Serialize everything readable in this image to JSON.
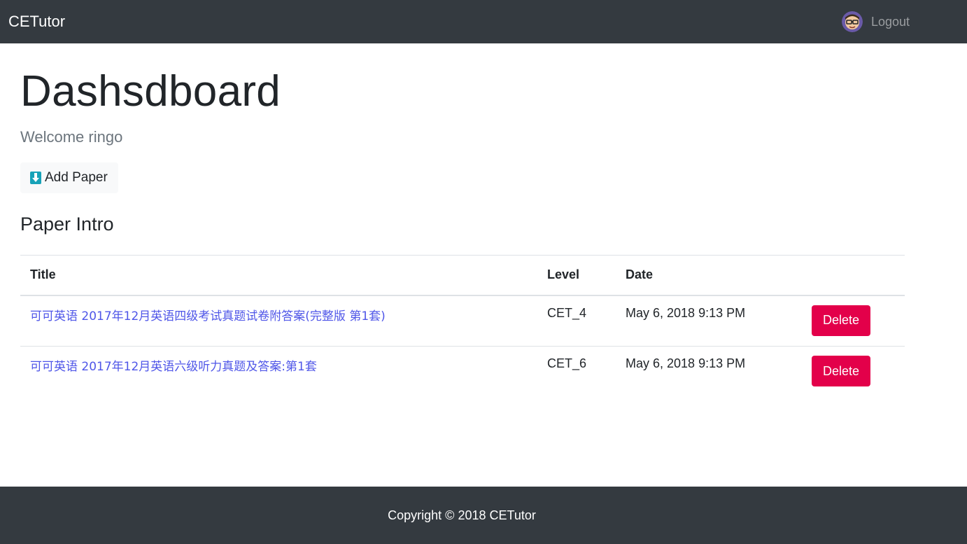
{
  "navbar": {
    "brand": "CETutor",
    "logout_label": "Logout"
  },
  "main": {
    "title": "Dashsdboard",
    "welcome": "Welcome ringo",
    "add_paper_label": "Add Paper",
    "section_title": "Paper Intro"
  },
  "table": {
    "headers": [
      "Title",
      "Level",
      "Date",
      ""
    ],
    "rows": [
      {
        "title": "可可英语 2017年12月英语四级考试真题试卷附答案(完整版 第1套)",
        "level": "CET_4",
        "date": "May 6, 2018 9:13 PM",
        "action": "Delete"
      },
      {
        "title": "可可英语 2017年12月英语六级听力真题及答案:第1套",
        "level": "CET_6",
        "date": "May 6, 2018 9:13 PM",
        "action": "Delete"
      }
    ]
  },
  "footer": {
    "copyright": "Copyright © 2018 CETutor"
  },
  "colors": {
    "navbar_bg": "#343a40",
    "link": "#4f56e8",
    "danger": "#e3004a",
    "muted": "#6c757d"
  },
  "icons": {
    "avatar": "user-avatar-icon",
    "add": "document-download-icon"
  }
}
